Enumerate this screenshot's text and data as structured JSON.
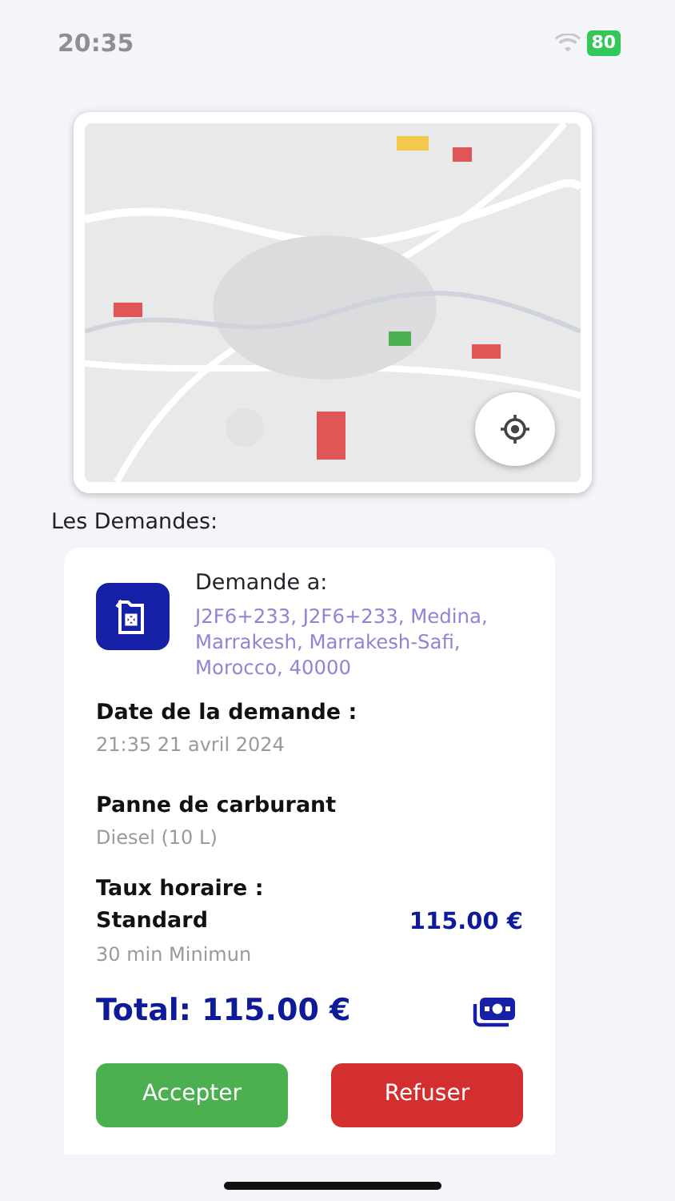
{
  "status_bar": {
    "time": "20:35",
    "battery": "80"
  },
  "section_title": "Les Demandes:",
  "request": {
    "heading": "Demande a:",
    "address": "J2F6+233, J2F6+233, Medina, Marrakesh, Marrakesh-Safi, Morocco, 40000",
    "date_label": "Date de la demande :",
    "date": "21:35 21 avril 2024",
    "service": "Panne de carburant",
    "service_detail": "Diesel (10 L)",
    "rate_label": "Taux horaire :",
    "rate_name": "Standard",
    "rate_price": "115.00 €",
    "rate_note": "30 min Minimun",
    "total": "Total: 115.00 €"
  },
  "buttons": [
    {
      "label": "Accepter",
      "kind": "accept"
    },
    {
      "label": "Refuser",
      "kind": "reject"
    }
  ]
}
